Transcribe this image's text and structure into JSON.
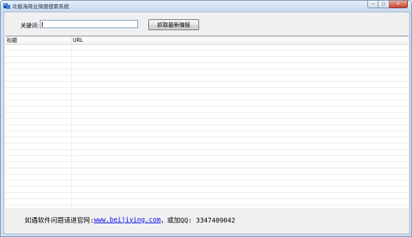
{
  "window": {
    "title": "北极海商业情报搜索系统",
    "controls": {
      "minimize": "—",
      "maximize": "□",
      "close": "✕"
    }
  },
  "search": {
    "keyword_label": "关键词:",
    "keyword_value": "",
    "fetch_button": "抓取最新情报"
  },
  "table": {
    "columns": [
      "标题",
      "URL"
    ],
    "rows": []
  },
  "footer": {
    "prefix": "如遇软件问题请进官网:",
    "link": "www.beijiying.com",
    "suffix": " ，或加QQ: 3347409042"
  },
  "colors": {
    "link": "#0000ee",
    "client_bg": "#f0f0f0",
    "frame": "#cfe0f1"
  }
}
